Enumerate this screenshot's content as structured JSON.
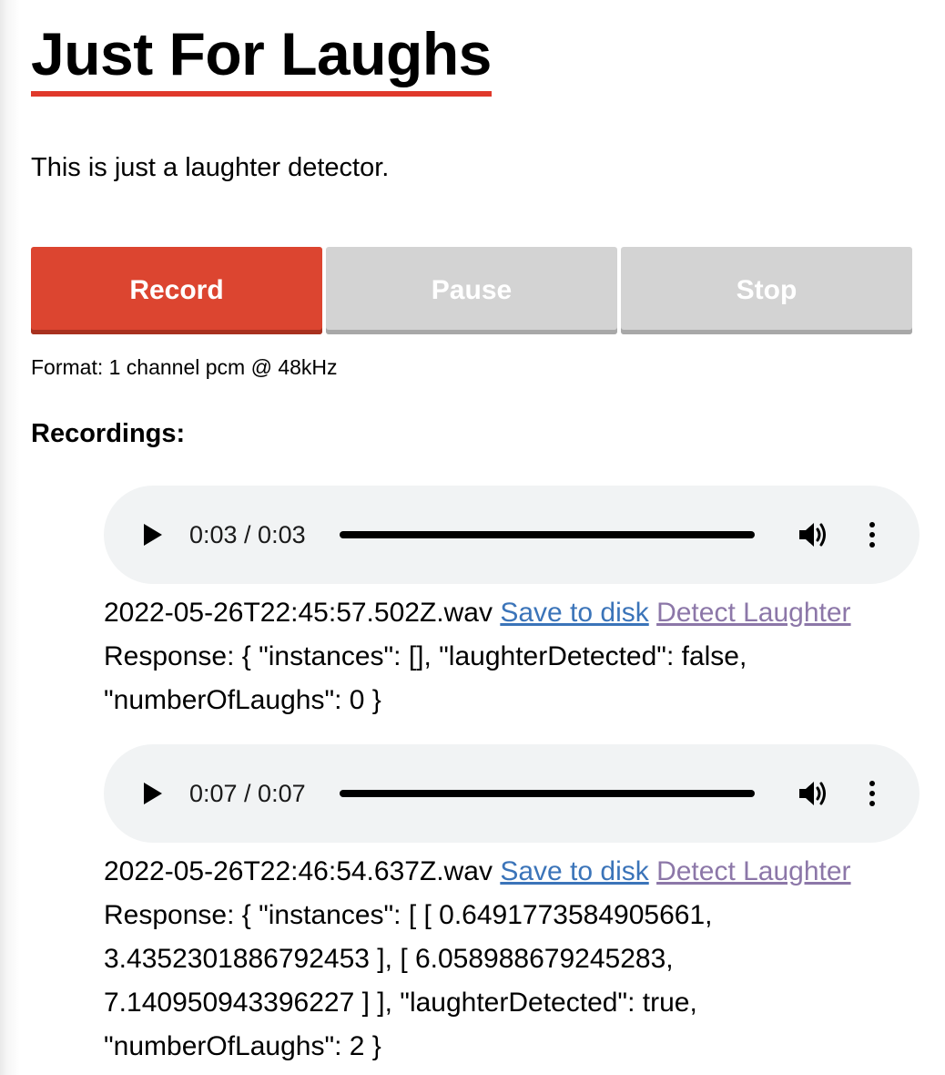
{
  "header": {
    "title": "Just For Laughs",
    "description": "This is just a laughter detector."
  },
  "controls": {
    "record_label": "Record",
    "pause_label": "Pause",
    "stop_label": "Stop",
    "format_text": "Format: 1 channel pcm @ 48kHz"
  },
  "recordings": {
    "heading": "Recordings:",
    "items": [
      {
        "time_display": "0:03 / 0:03",
        "filename": "2022-05-26T22:45:57.502Z.wav",
        "save_label": "Save to disk",
        "detect_label": "Detect Laughter",
        "response_text": "Response: { \"instances\": [], \"laughterDetected\": false, \"numberOfLaughs\": 0 }"
      },
      {
        "time_display": "0:07 / 0:07",
        "filename": "2022-05-26T22:46:54.637Z.wav",
        "save_label": "Save to disk",
        "detect_label": "Detect Laughter",
        "response_text": "Response: { \"instances\": [ [ 0.6491773584905661, 3.4352301886792453 ], [ 6.058988679245283, 7.140950943396227 ] ], \"laughterDetected\": true, \"numberOfLaughs\": 2 }"
      }
    ]
  },
  "colors": {
    "accent_red": "#dc4530",
    "title_underline": "#e0392b",
    "disabled_button": "#d3d3d3",
    "link_blue": "#3b74b9",
    "link_visited_purple": "#8c77a8",
    "player_background": "#f1f3f4"
  },
  "icons": {
    "play": "play-icon",
    "volume": "volume-icon",
    "more": "more-vertical-icon"
  }
}
